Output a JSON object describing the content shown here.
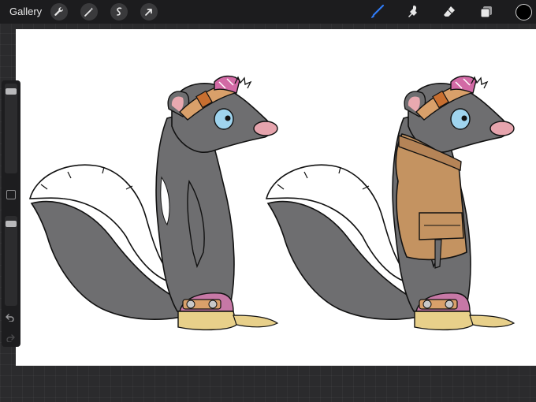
{
  "topbar": {
    "gallery_label": "Gallery",
    "left_tools": [
      "wrench-icon",
      "magic-wand-icon",
      "selection-icon",
      "transform-arrow-icon"
    ],
    "right_tools": [
      "brush-icon",
      "smudge-icon",
      "eraser-icon",
      "layers-icon"
    ],
    "active_tool": "brush-icon",
    "active_tool_color": "#2f7bf5",
    "current_color": "#000000"
  },
  "sidebar": {
    "brush_size_level": 0.97,
    "opacity_level": 0.97,
    "undo_icon": "undo-icon",
    "redo_icon": "redo-icon"
  },
  "canvas": {
    "background": "#ffffff",
    "artwork": "two-skunk-character-drawings"
  }
}
